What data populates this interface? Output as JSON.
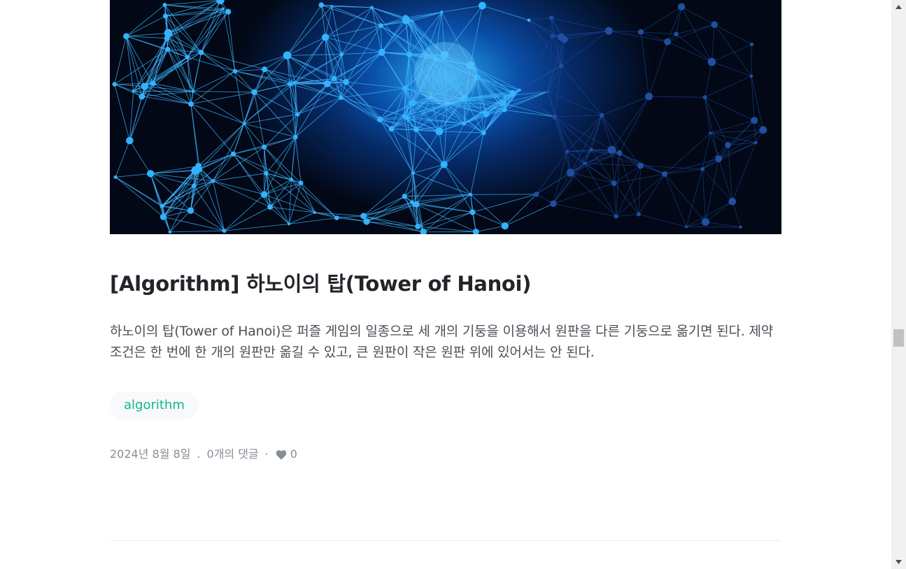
{
  "post": {
    "thumbnail_alt": "network-thumbnail",
    "title": "[Algorithm] 하노이의 탑(Tower of Hanoi)",
    "description": "하노이의 탑(Tower of Hanoi)은 퍼즐 게임의 일종으로 세 개의 기둥을 이용해서 원판을 다른 기둥으로 옮기면 된다. 제약 조건은 한 번에 한 개의 원판만 옮길 수 있고, 큰 원판이 작은 원판 위에 있어서는 안 된다.",
    "tags": [
      "algorithm"
    ],
    "date": "2024년 8월 8일",
    "separator": ".",
    "comments": "0개의 댓글",
    "dot": "·",
    "heart_icon": "heart-icon",
    "likes": "0"
  },
  "colors": {
    "tag_text": "#12b886",
    "tag_bg": "#f8f9fa",
    "title": "#212529",
    "body_text": "#495057",
    "meta_text": "#868e96"
  }
}
